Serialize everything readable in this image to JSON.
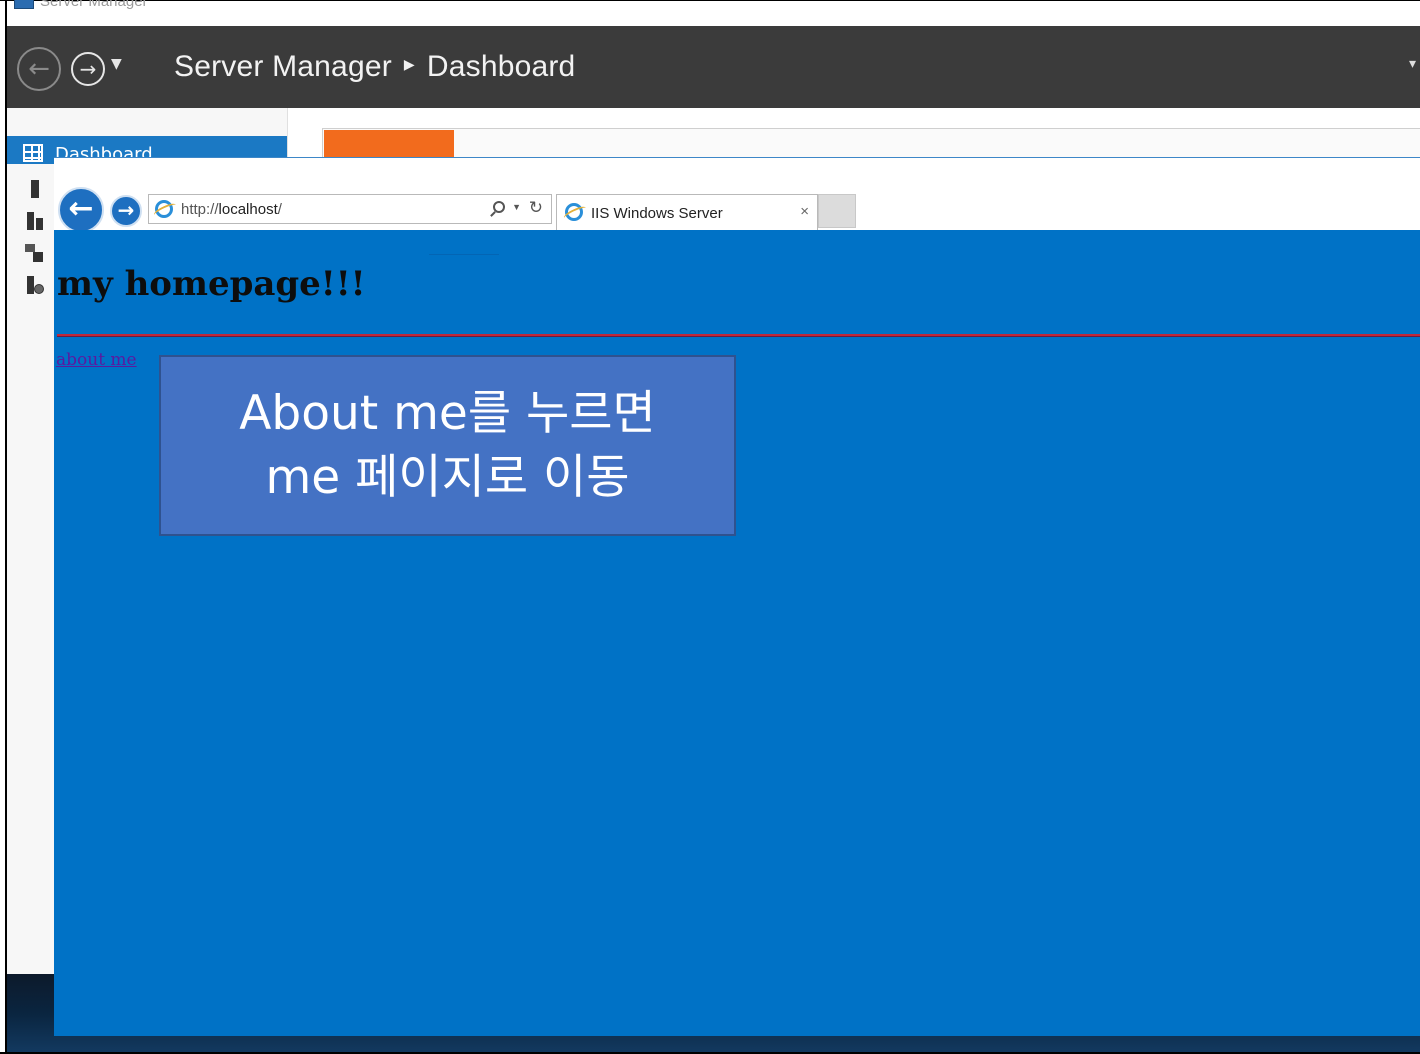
{
  "server_manager": {
    "window_title": "Server Manager",
    "breadcrumb": {
      "app": "Server Manager",
      "page": "Dashboard"
    },
    "left_pane": {
      "items": [
        {
          "label": "Dashboard",
          "icon": "dashboard-grid-icon",
          "selected": true
        },
        {
          "label": "",
          "icon": "local-server-icon"
        },
        {
          "label": "",
          "icon": "all-servers-icon"
        },
        {
          "label": "",
          "icon": "file-storage-icon"
        },
        {
          "label": "",
          "icon": "iis-icon"
        }
      ]
    }
  },
  "browser": {
    "address_url_prefix": "http://",
    "address_url_host": "localhost",
    "address_url_suffix": "/",
    "tab_title": "IIS Windows Server",
    "tab_close_glyph": "×"
  },
  "page": {
    "heading": "my homepage!!!",
    "link_text": "about me",
    "colors": {
      "background": "#0072c6",
      "rule": "#c0283a",
      "link": "#5a1aa0"
    }
  },
  "annotation": {
    "line1": "About me를 누르면",
    "line2": "me 페이지로 이동",
    "background_color": "#4472c4"
  }
}
